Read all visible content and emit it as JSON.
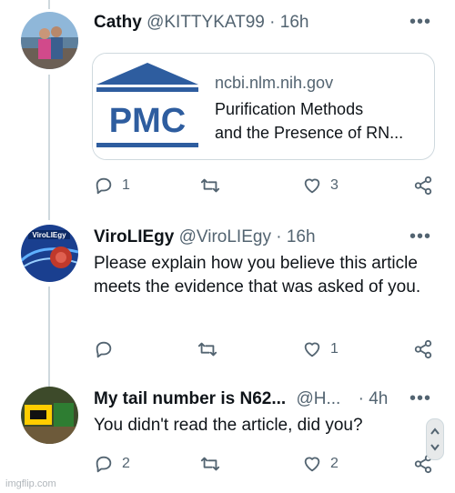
{
  "tweets": [
    {
      "name": "Cathy",
      "handle": "@KITTYKAT99",
      "time": "· 16h",
      "more": "•••",
      "card": {
        "logo": "PMC",
        "domain": "ncbi.nlm.nih.gov",
        "title_line1": "Purification Methods",
        "title_line2": "and the Presence of RN..."
      },
      "reply_count": "1",
      "retweet_count": "",
      "like_count": "3"
    },
    {
      "name": "ViroLIEgy",
      "handle": "@ViroLIEgy",
      "time": "· 16h",
      "more": "•••",
      "avatar_text": "ViroLIEgy",
      "text": "Please explain how you believe this article meets the evidence that was asked of you.",
      "reply_count": "",
      "retweet_count": "",
      "like_count": "1"
    },
    {
      "name": "My tail number is N62...",
      "handle": "@H...",
      "time": "· 4h",
      "more": "•••",
      "text": "You didn't read the article, did you?",
      "reply_count": "2",
      "retweet_count": "",
      "like_count": "2"
    }
  ],
  "watermark": "imgflip.com",
  "colors": {
    "text": "#0f1419",
    "muted": "#536471",
    "border": "#cfd9de",
    "pmc_blue": "#2e5d9f"
  }
}
